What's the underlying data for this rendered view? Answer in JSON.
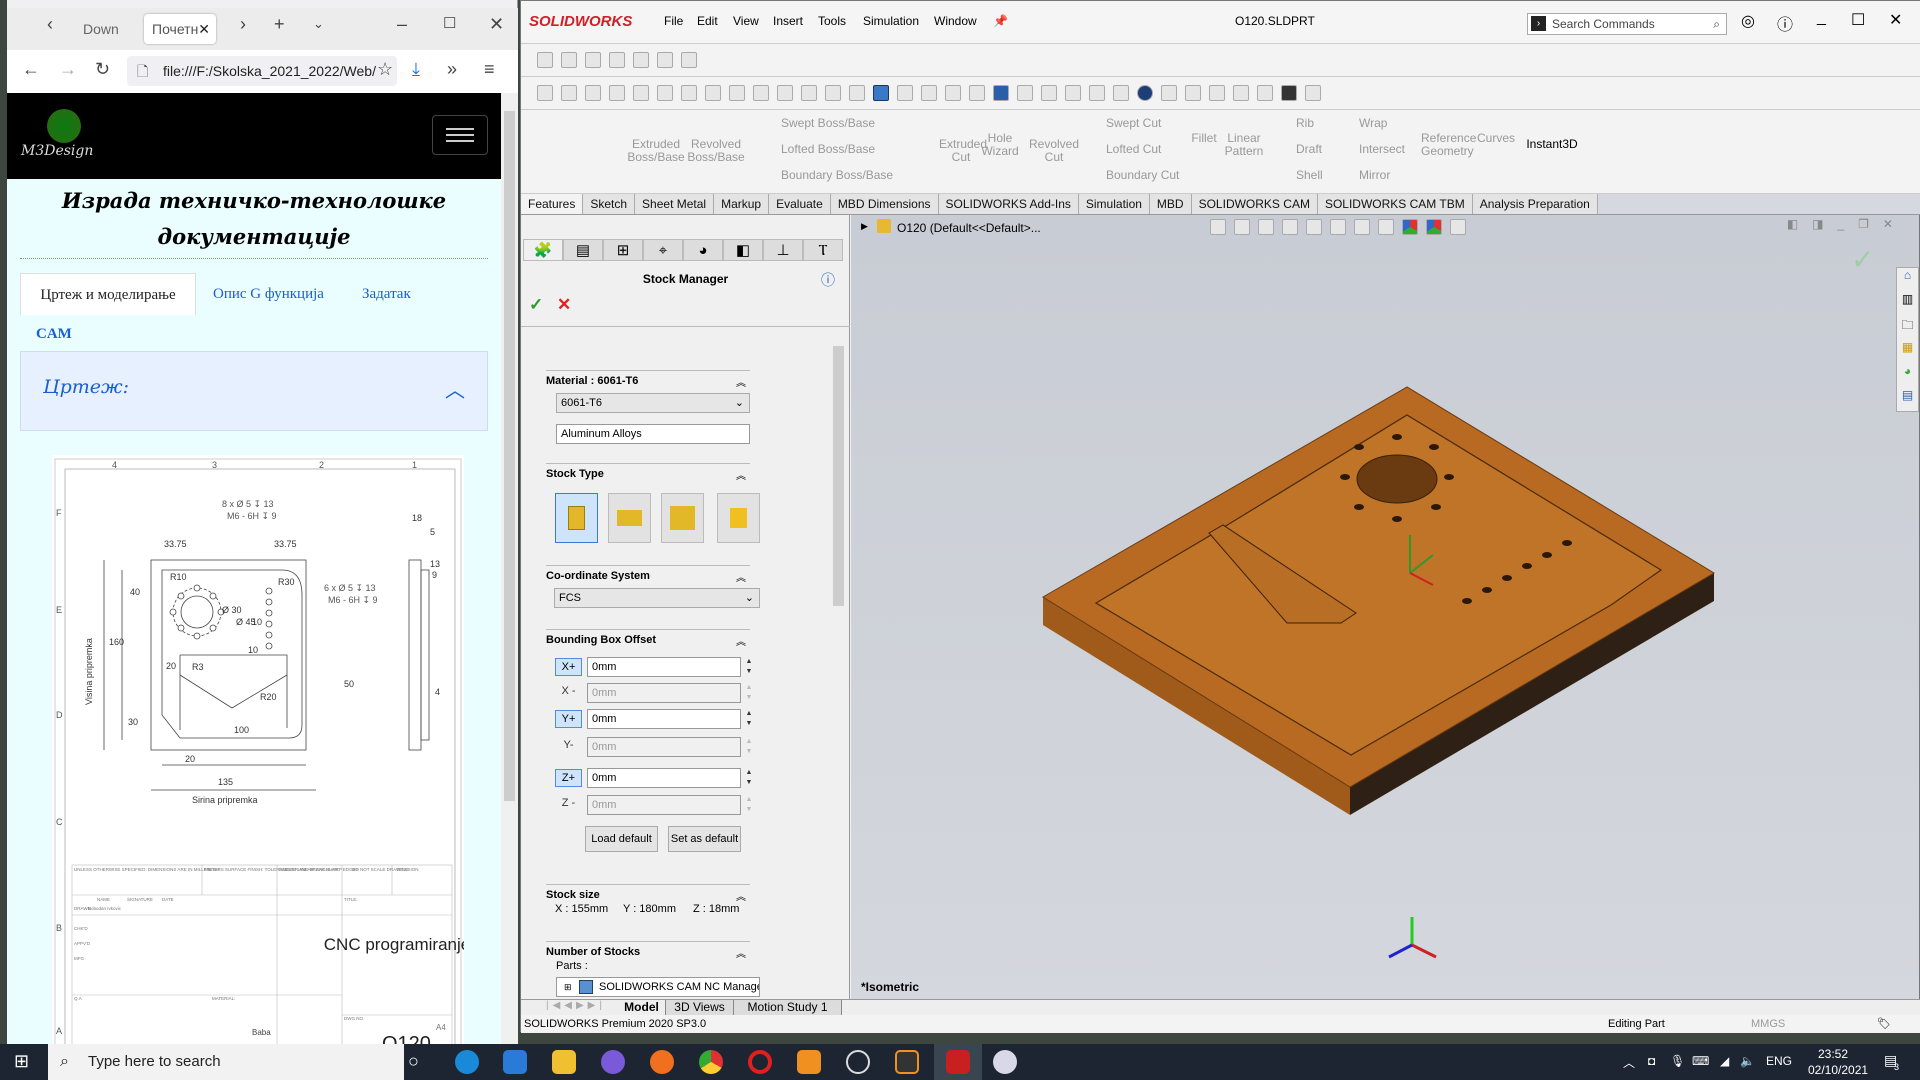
{
  "browser": {
    "tabs": [
      {
        "label": "Down"
      },
      {
        "label": "Почетн"
      }
    ],
    "url": "file:///F:/Skolska_2021_2022/Web/",
    "site": {
      "logo": "M3Design",
      "title_line1": "Израда техничко-технолошке",
      "title_line2": "документације",
      "tabs": [
        {
          "label": "Цртеж и моделирање",
          "active": true
        },
        {
          "label": "Опис G функција"
        },
        {
          "label": "Задатак"
        },
        {
          "label": "CAM"
        }
      ],
      "accordion": {
        "title": "Цртеж:"
      }
    },
    "drawing": {
      "zone_cols": [
        "4",
        "3",
        "2",
        "1"
      ],
      "zone_rows": [
        "F",
        "E",
        "D",
        "C",
        "B",
        "A"
      ],
      "notes": [
        "8 x Ø 5 ↧ 13",
        "M6 - 6H ↧ 9",
        "6 x Ø 5 ↧ 13",
        "M6 - 6H ↧ 9"
      ],
      "dims": [
        "33.75",
        "33.75",
        "R10",
        "R30",
        "40",
        "Ø 30",
        "Ø 45",
        "10",
        "10",
        "20",
        "R3",
        "50",
        "R20",
        "100",
        "30",
        "160",
        "20",
        "135",
        "18",
        "5",
        "13",
        "9",
        "4"
      ],
      "height_label": "Visina pripremka",
      "width_label": "Sirina pripremka",
      "title_block": {
        "title": "CNC programiranje",
        "dwg_no": "O120",
        "size": "A4",
        "material": "Baba",
        "drawn_by": "Bobodan Ivkovic",
        "general_notes": "UNLESS OTHERWISE SPECIFIED: DIMENSIONS ARE IN MILLIMETERS SURFACE FINISH: TOLERANCES: LINEAR: ANGULAR:",
        "finish": "FINISH:",
        "deburr": "DEBURR AND BREAK SHARP EDGES",
        "do_not_scale": "DO NOT SCALE DRAWING",
        "revision": "REVISION",
        "cols": [
          "NAME",
          "SIGNATURE",
          "DATE"
        ],
        "rows": [
          "DRAWN",
          "CHK'D",
          "APPV'D",
          "MFG",
          "Q.A"
        ],
        "title_lbl": "TITLE:",
        "material_lbl": "MATERIAL:",
        "dwg_lbl": "DWG NO."
      }
    }
  },
  "sw": {
    "brand": "SOLIDWORKS",
    "menu": [
      "File",
      "Edit",
      "View",
      "Insert",
      "Tools",
      "Simulation",
      "Window"
    ],
    "doc_title": "O120.SLDPRT",
    "search_placeholder": "Search Commands",
    "commands": {
      "extruded_boss": "Extruded Boss/Base",
      "revolved_boss": "Revolved Boss/Base",
      "swept_boss": "Swept Boss/Base",
      "lofted_boss": "Lofted Boss/Base",
      "boundary_boss": "Boundary Boss/Base",
      "extruded_cut": "Extruded Cut",
      "hole_wizard": "Hole Wizard",
      "revolved_cut": "Revolved Cut",
      "swept_cut": "Swept Cut",
      "lofted_cut": "Lofted Cut",
      "boundary_cut": "Boundary Cut",
      "fillet": "Fillet",
      "linear_pattern": "Linear Pattern",
      "rib": "Rib",
      "draft": "Draft",
      "shell": "Shell",
      "wrap": "Wrap",
      "intersect": "Intersect",
      "mirror": "Mirror",
      "ref_geom": "Reference Geometry",
      "curves": "Curves",
      "instant3d": "Instant3D"
    },
    "cm_tabs": [
      "Features",
      "Sketch",
      "Sheet Metal",
      "Markup",
      "Evaluate",
      "MBD Dimensions",
      "SOLIDWORKS Add-Ins",
      "Simulation",
      "MBD",
      "SOLIDWORKS CAM",
      "SOLIDWORKS CAM TBM",
      "Analysis Preparation"
    ],
    "tree_item": "O120  (Default<<Default>...",
    "pm": {
      "title": "Stock Manager",
      "material_hdr": "Material : 6061-T6",
      "material_value": "6061-T6",
      "material_class": "Aluminum Alloys",
      "stock_type_hdr": "Stock Type",
      "cs_hdr": "Co-ordinate System",
      "cs_value": "FCS",
      "bbox_hdr": "Bounding Box Offset",
      "offsets": [
        {
          "axis": "X+",
          "value": "0mm",
          "enabled": true
        },
        {
          "axis": "X -",
          "value": "0mm",
          "enabled": false
        },
        {
          "axis": "Y+",
          "value": "0mm",
          "enabled": true
        },
        {
          "axis": "Y-",
          "value": "0mm",
          "enabled": false
        },
        {
          "axis": "Z+",
          "value": "0mm",
          "enabled": true
        },
        {
          "axis": "Z -",
          "value": "0mm",
          "enabled": false
        }
      ],
      "load_default": "Load default",
      "set_default": "Set as default",
      "stock_size_hdr": "Stock size",
      "size_x": "X : 155mm",
      "size_y": "Y : 180mm",
      "size_z": "Z : 18mm",
      "num_stocks_hdr": "Number of Stocks",
      "parts_lbl": "Parts :",
      "parts_item": "SOLIDWORKS CAM NC Manager"
    },
    "view_name": "*Isometric",
    "bottom_tabs": [
      "Model",
      "3D Views",
      "Motion Study 1"
    ],
    "status": {
      "version": "SOLIDWORKS Premium 2020 SP3.0",
      "mode": "Editing Part",
      "units": "MMGS"
    }
  },
  "taskbar": {
    "search": "Type here to search",
    "lang": "ENG",
    "time": "23:52",
    "date": "02/10/2021",
    "notifications": "3"
  }
}
